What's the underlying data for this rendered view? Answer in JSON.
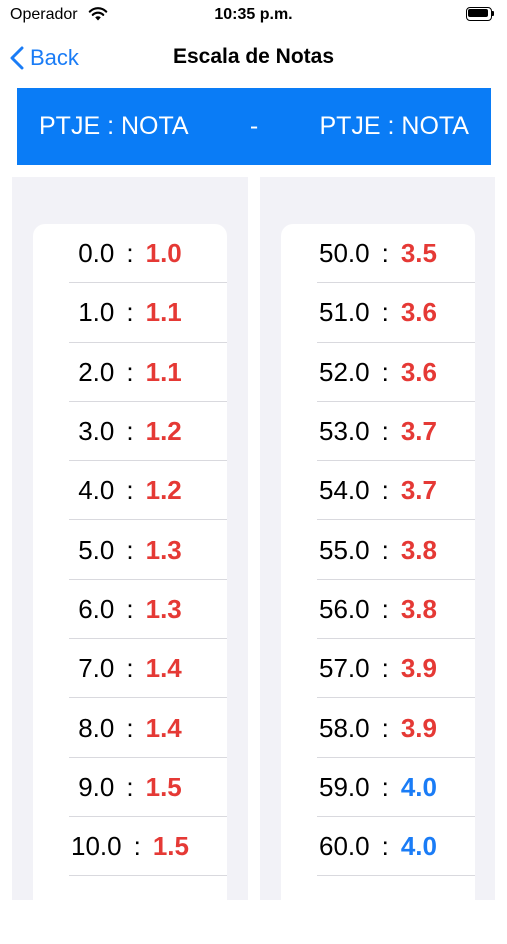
{
  "status_bar": {
    "carrier": "Operador",
    "time": "10:35 p.m."
  },
  "nav": {
    "back_label": "Back",
    "title": "Escala de Notas"
  },
  "header": {
    "left": "PTJE : NOTA",
    "separator": "-",
    "right": "PTJE : NOTA"
  },
  "colors": {
    "fail": "#e53935",
    "pass": "#1a7cf6",
    "banner": "#0a7cf6"
  },
  "left_rows": [
    {
      "ptje": "0.0",
      "nota": "1.0"
    },
    {
      "ptje": "1.0",
      "nota": "1.1"
    },
    {
      "ptje": "2.0",
      "nota": "1.1"
    },
    {
      "ptje": "3.0",
      "nota": "1.2"
    },
    {
      "ptje": "4.0",
      "nota": "1.2"
    },
    {
      "ptje": "5.0",
      "nota": "1.3"
    },
    {
      "ptje": "6.0",
      "nota": "1.3"
    },
    {
      "ptje": "7.0",
      "nota": "1.4"
    },
    {
      "ptje": "8.0",
      "nota": "1.4"
    },
    {
      "ptje": "9.0",
      "nota": "1.5"
    },
    {
      "ptje": "10.0",
      "nota": "1.5"
    }
  ],
  "right_rows": [
    {
      "ptje": "50.0",
      "nota": "3.5"
    },
    {
      "ptje": "51.0",
      "nota": "3.6"
    },
    {
      "ptje": "52.0",
      "nota": "3.6"
    },
    {
      "ptje": "53.0",
      "nota": "3.7"
    },
    {
      "ptje": "54.0",
      "nota": "3.7"
    },
    {
      "ptje": "55.0",
      "nota": "3.8"
    },
    {
      "ptje": "56.0",
      "nota": "3.8"
    },
    {
      "ptje": "57.0",
      "nota": "3.9"
    },
    {
      "ptje": "58.0",
      "nota": "3.9"
    },
    {
      "ptje": "59.0",
      "nota": "4.0"
    },
    {
      "ptje": "60.0",
      "nota": "4.0"
    }
  ]
}
